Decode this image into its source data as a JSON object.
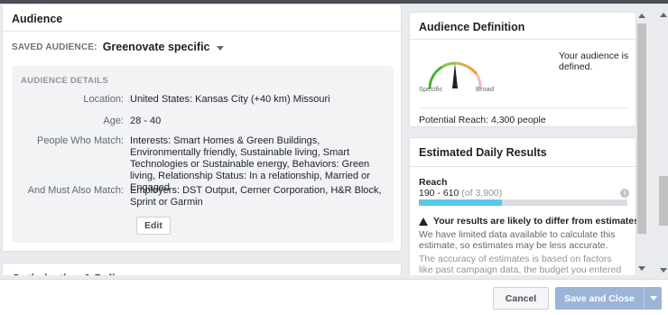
{
  "audience": {
    "title": "Audience",
    "saved_label": "SAVED AUDIENCE:",
    "saved_name": "Greenovate specific",
    "details_title": "AUDIENCE DETAILS",
    "rows": [
      {
        "label": "Location:",
        "value": "United States: Kansas City (+40 km) Missouri"
      },
      {
        "label": "Age:",
        "value": "28 - 40"
      },
      {
        "label": "People Who Match:",
        "value": "Interests: Smart Homes & Green Buildings, Environmentally friendly, Sustainable living, Smart Technologies or Sustainable energy, Behaviors: Green living, Relationship Status: In a relationship, Married or Engaged"
      },
      {
        "label": "And Must Also Match:",
        "value": "Employers: DST Output, Cerner Corporation, H&R Block, Sprint or Garmin"
      }
    ],
    "edit_label": "Edit"
  },
  "optimization": {
    "title": "Optimization & Delivery"
  },
  "definition": {
    "title": "Audience Definition",
    "specific_label": "Specific",
    "broad_label": "Broad",
    "status": "Your audience is defined.",
    "potential_reach": "Potential Reach: 4,300 people",
    "gauge_level": 0.5
  },
  "estimated": {
    "title": "Estimated Daily Results",
    "reach_label": "Reach",
    "reach_range": "190 - 610",
    "reach_of": "(of 3,900)",
    "reach_fill_fraction": 0.4,
    "warning_title": "Your results are likely to differ from estimates",
    "warning_text": "We have limited data available to calculate this estimate, so estimates may be less accurate.",
    "accuracy_text": "The accuracy of estimates is based on factors like past campaign data, the budget you entered and market data. Numbers are provided to give you an idea of"
  },
  "footer": {
    "cancel_label": "Cancel",
    "save_label": "Save and Close"
  },
  "colors": {
    "accent": "#5ac8e5",
    "primary_disabled": "#9cb4d8",
    "gauge_green": "#42b72a",
    "gauge_red": "#e0383e"
  }
}
